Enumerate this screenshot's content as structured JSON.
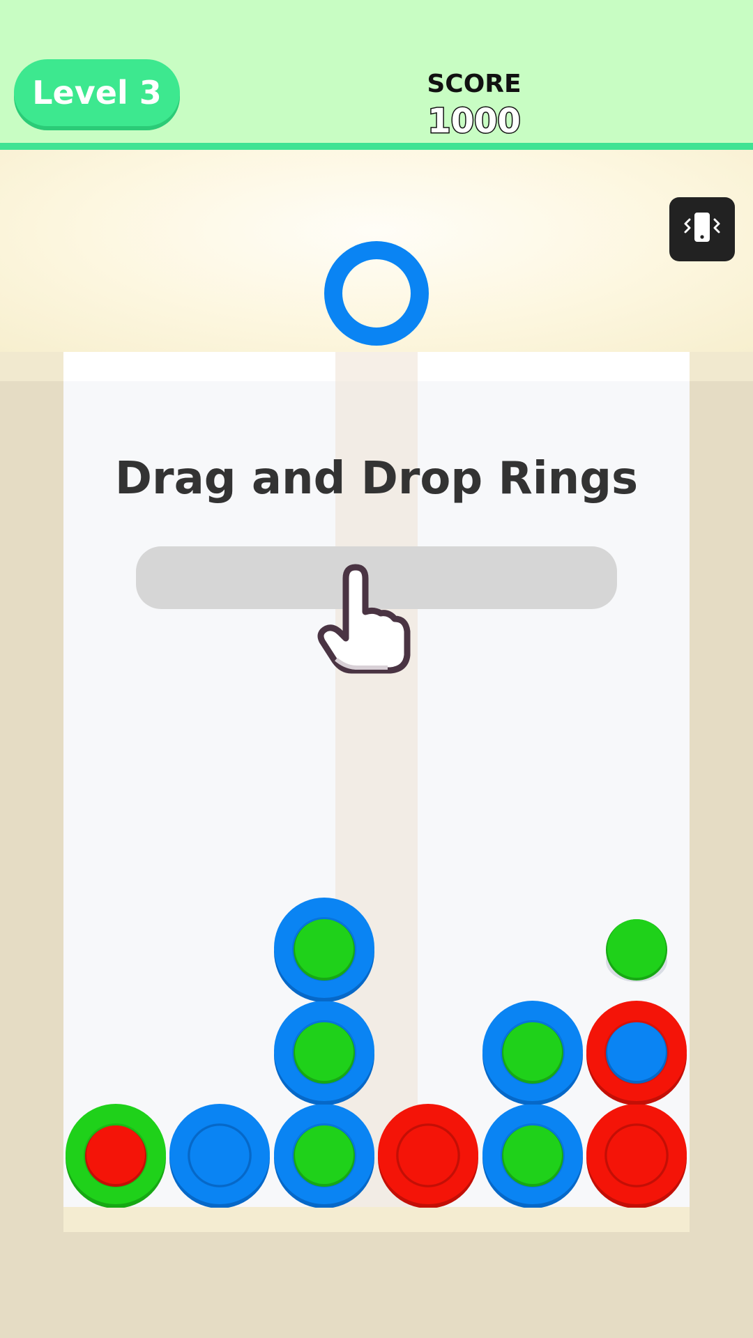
{
  "header": {
    "level_label": "Level 3",
    "score_label": "SCORE",
    "score_value": "1000"
  },
  "controls": {
    "vibrate_icon": "phone-vibrate-icon"
  },
  "board": {
    "title": "Drag and Drop Rings",
    "hand_icon": "pointing-hand-icon",
    "floating_ring": {
      "color": "blue"
    }
  },
  "colors": {
    "header_bg": "#c8fdc3",
    "badge_green": "#3de88f",
    "blue": "#0a84f3",
    "green": "#1fd11a",
    "red": "#f41408",
    "text_dark": "#333333"
  },
  "columns": [
    {
      "stack": [
        {
          "outer": "green",
          "inner": "red"
        }
      ]
    },
    {
      "stack": [
        {
          "outer": "blue",
          "inner": "none"
        }
      ]
    },
    {
      "stack": [
        {
          "outer": "blue",
          "inner": "green"
        },
        {
          "outer": "blue",
          "inner": "green"
        },
        {
          "outer": "blue",
          "inner": "green"
        }
      ]
    },
    {
      "stack": [
        {
          "outer": "red",
          "inner": "none"
        }
      ]
    },
    {
      "stack": [
        {
          "outer": "blue",
          "inner": "green"
        },
        {
          "outer": "blue",
          "inner": "green"
        }
      ]
    },
    {
      "stack": [
        {
          "outer": "red",
          "inner": "none"
        },
        {
          "outer": "red",
          "inner": "blue"
        },
        {
          "outer": "none",
          "inner": "green"
        }
      ]
    }
  ]
}
